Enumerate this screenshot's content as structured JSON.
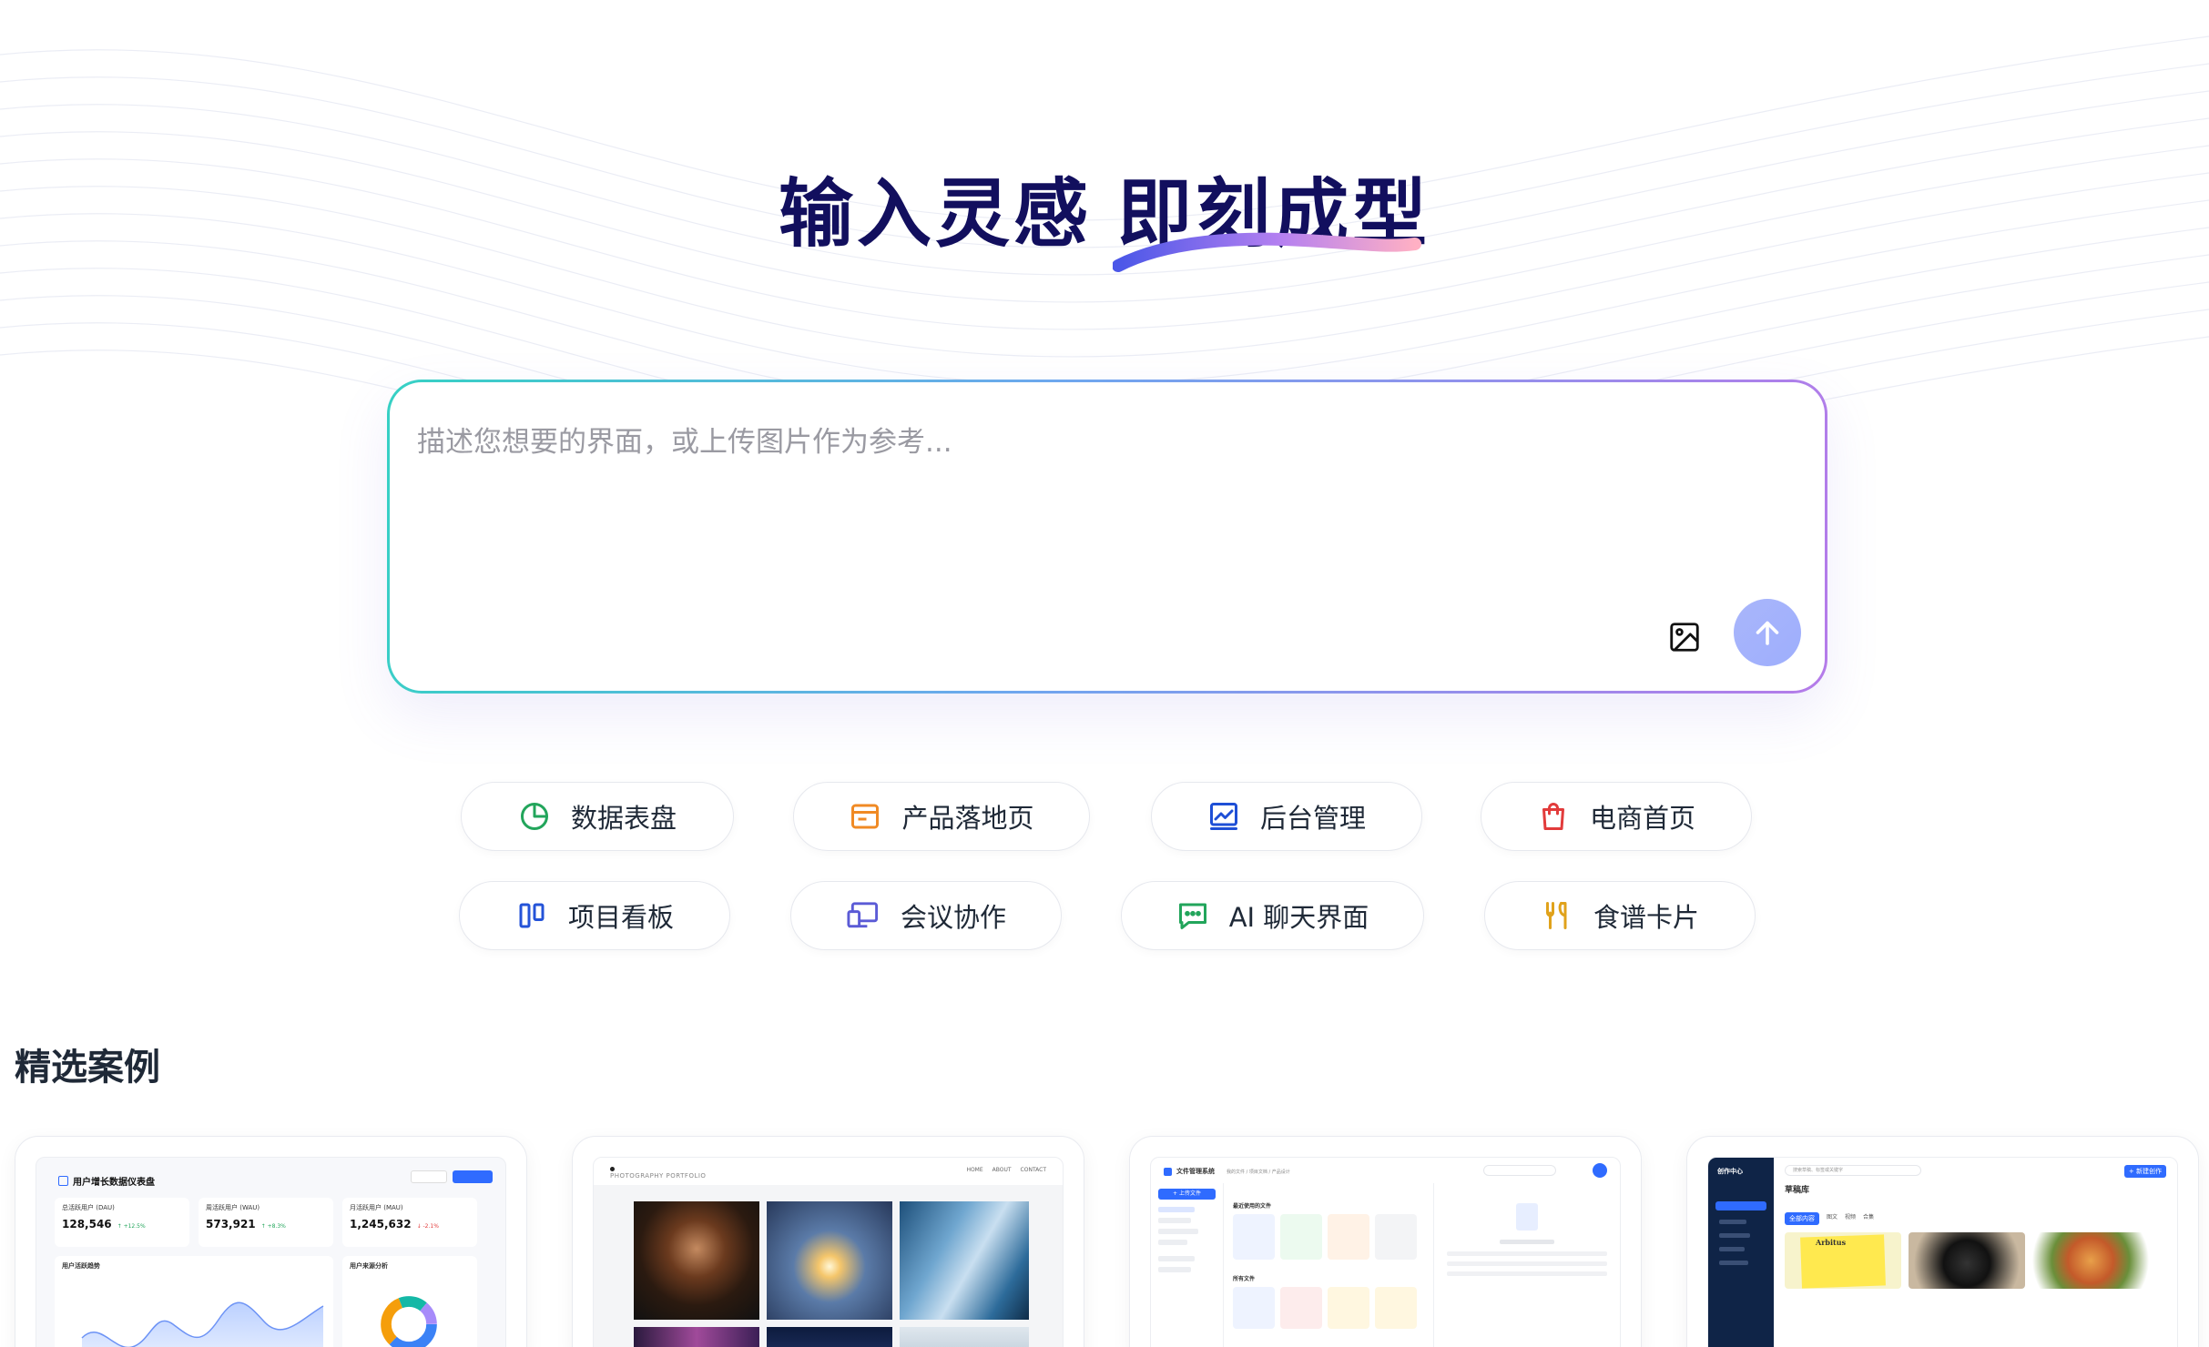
{
  "hero": {
    "title_part1": "输入灵感",
    "title_part2": "即刻成型"
  },
  "prompt": {
    "placeholder": "描述您想要的界面，或上传图片作为参考...",
    "upload_icon": "image-icon",
    "send_icon": "arrow-up-icon"
  },
  "chips": [
    {
      "label": "数据表盘",
      "icon": "pie-chart-icon",
      "color": "#22a55b"
    },
    {
      "label": "产品落地页",
      "icon": "browser-window-icon",
      "color": "#f08a24"
    },
    {
      "label": "后台管理",
      "icon": "line-chart-icon",
      "color": "#1e4fd6"
    },
    {
      "label": "电商首页",
      "icon": "shopping-bag-icon",
      "color": "#e23b3b"
    },
    {
      "label": "项目看板",
      "icon": "kanban-icon",
      "color": "#2453d8"
    },
    {
      "label": "会议协作",
      "icon": "devices-icon",
      "color": "#5b5bd6"
    },
    {
      "label": "AI 聊天界面",
      "icon": "chat-bubble-icon",
      "color": "#22a55b"
    },
    {
      "label": "食谱卡片",
      "icon": "utensils-icon",
      "color": "#e0a21b"
    }
  ],
  "section": {
    "title": "精选案例"
  },
  "cases": [
    {
      "title": "用户增长数据仪表盘",
      "stats": [
        {
          "label": "总活跃用户 (DAU)",
          "value": "128,546",
          "delta": "↑ +12.5%"
        },
        {
          "label": "周活跃用户 (WAU)",
          "value": "573,921",
          "delta": "↑ +8.3%"
        },
        {
          "label": "月活跃用户 (MAU)",
          "value": "1,245,632",
          "delta": "↓ -2.1%"
        }
      ],
      "chart_title": "用户活跃趋势",
      "pie_title": "用户来源分析"
    },
    {
      "brand": "PHOTOGRAPHY PORTFOLIO",
      "nav": [
        "HOME",
        "ABOUT",
        "CONTACT"
      ]
    },
    {
      "app_name": "文件管理系统",
      "breadcrumb": "我的文件 / 项目文档 / 产品设计",
      "upload_label": "+ 上传文件",
      "recent_label": "最近使用的文件",
      "all_label": "所有文件"
    },
    {
      "app_name": "创作中心",
      "search_placeholder": "搜索草稿、标签或关键字",
      "new_label": "+ 新建创作",
      "page_title": "草稿库",
      "tabs": [
        "全部内容",
        "图文",
        "视频",
        "合集"
      ],
      "cover_word": "Arbitus"
    }
  ]
}
